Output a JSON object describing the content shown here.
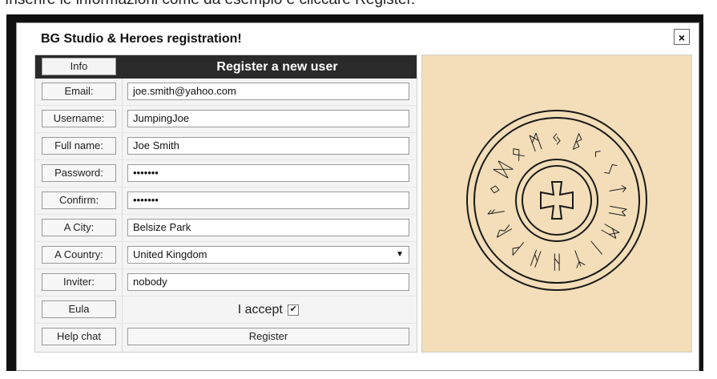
{
  "instruction": "Inserire le informazioni come da esempio e cliccare Register.",
  "dialog": {
    "title": "BG Studio & Heroes registration!",
    "close": "×"
  },
  "form": {
    "info_button": "Info",
    "header": "Register a new user",
    "email": {
      "label": "Email:",
      "value": "joe.smith@yahoo.com"
    },
    "username": {
      "label": "Username:",
      "value": "JumpingJoe"
    },
    "fullname": {
      "label": "Full name:",
      "value": "Joe Smith"
    },
    "password": {
      "label": "Password:",
      "value": "•••••••"
    },
    "confirm": {
      "label": "Confirm:",
      "value": "•••••••"
    },
    "city": {
      "label": "A City:",
      "value": "Belsize Park"
    },
    "country": {
      "label": "A Country:",
      "value": "United Kingdom"
    },
    "inviter": {
      "label": "Inviter:",
      "value": "nobody"
    },
    "eula": {
      "label": "Eula",
      "accept_text": "I accept",
      "checked": true
    },
    "helpchat": {
      "label": "Help chat"
    },
    "register": "Register"
  },
  "emblem": {
    "runes_outer": [
      "ᛞ",
      "ᛟ",
      "ᛗ",
      "ᛃ",
      "ᛒ",
      "ᚲ",
      "ᛊ",
      "ᛏ",
      "ᛖ",
      "ᛗ",
      "ᛁ",
      "ᛉ",
      "ᚺ",
      "ᚺ",
      "ᚹ",
      "ᚱ",
      "ᚨ",
      "ᛜ"
    ],
    "background_color": "#f3deb9",
    "ink_color": "#1a1a1a"
  }
}
